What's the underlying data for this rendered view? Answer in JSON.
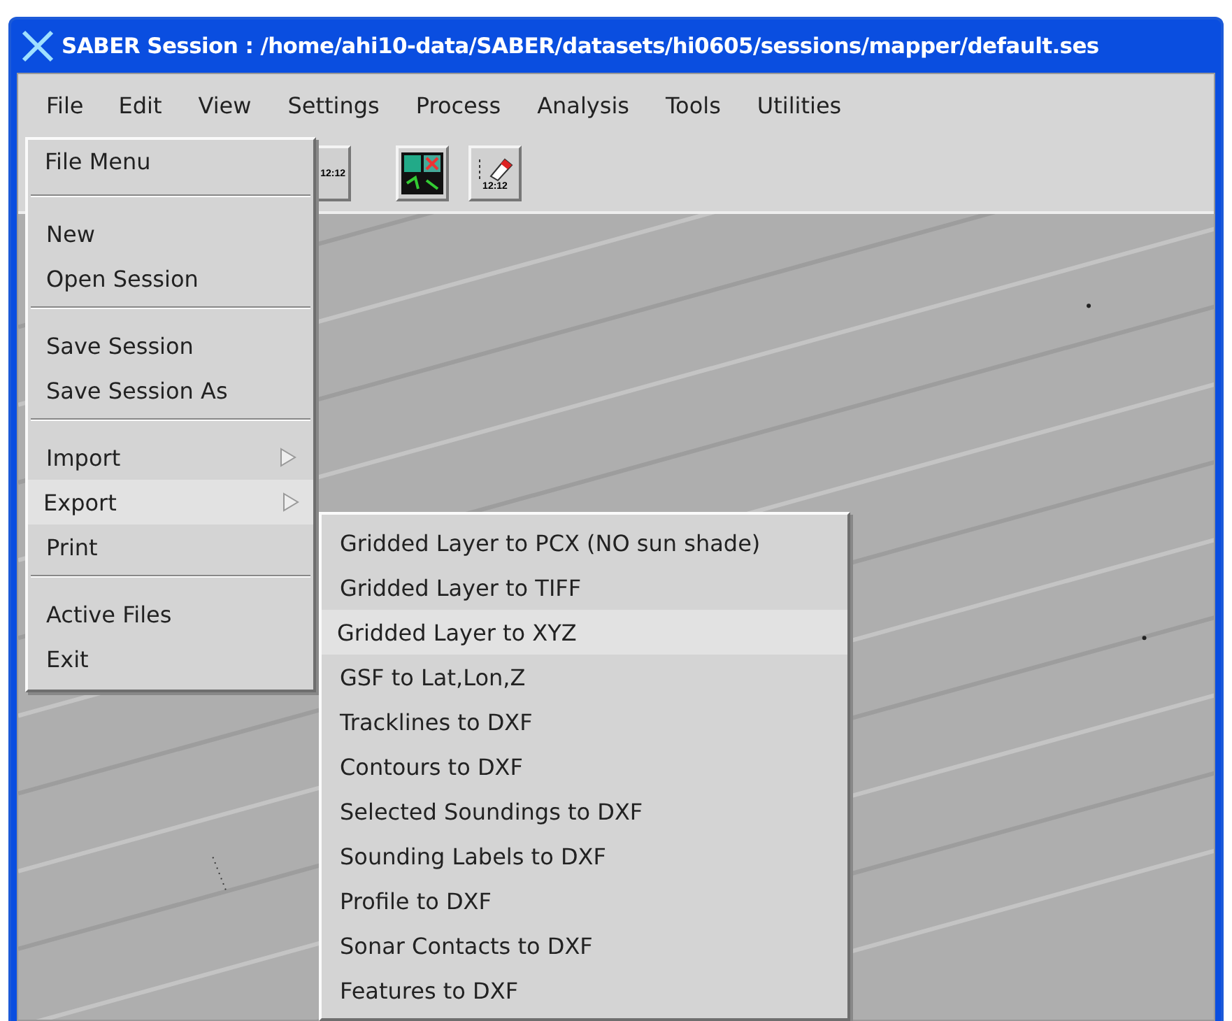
{
  "window": {
    "title": "SABER Session : /home/ahi10-data/SABER/datasets/hi0605/sessions/mapper/default.ses"
  },
  "menubar": [
    {
      "label": "File",
      "selected": true
    },
    {
      "label": "Edit",
      "selected": false
    },
    {
      "label": "View",
      "selected": false
    },
    {
      "label": "Settings",
      "selected": false
    },
    {
      "label": "Process",
      "selected": false
    },
    {
      "label": "Analysis",
      "selected": false
    },
    {
      "label": "Tools",
      "selected": false
    },
    {
      "label": "Utilities",
      "selected": false
    }
  ],
  "toolbar": [
    {
      "kind": "label-tool",
      "label": "12:12"
    },
    {
      "kind": "map-tool"
    },
    {
      "kind": "erase-tool",
      "label": "12:12"
    }
  ],
  "file_menu": {
    "title": "File Menu",
    "groups": [
      [
        {
          "label": "New",
          "selected": false,
          "submenu": false
        },
        {
          "label": "Open Session",
          "selected": false,
          "submenu": false
        }
      ],
      [
        {
          "label": "Save Session",
          "selected": false,
          "submenu": false
        },
        {
          "label": "Save Session As",
          "selected": false,
          "submenu": false
        }
      ],
      [
        {
          "label": "Import",
          "selected": false,
          "submenu": true
        },
        {
          "label": "Export",
          "selected": true,
          "submenu": true
        },
        {
          "label": "Print",
          "selected": false,
          "submenu": false
        }
      ],
      [
        {
          "label": "Active Files",
          "selected": false,
          "submenu": false
        },
        {
          "label": "Exit",
          "selected": false,
          "submenu": false
        }
      ]
    ]
  },
  "export_menu": [
    {
      "label": "Gridded Layer to PCX (NO sun shade)",
      "selected": false
    },
    {
      "label": "Gridded Layer to TIFF",
      "selected": false
    },
    {
      "label": "Gridded Layer to XYZ",
      "selected": true
    },
    {
      "label": "GSF to Lat,Lon,Z",
      "selected": false
    },
    {
      "label": "Tracklines to DXF",
      "selected": false
    },
    {
      "label": "Contours to DXF",
      "selected": false
    },
    {
      "label": "Selected Soundings to DXF",
      "selected": false
    },
    {
      "label": "Sounding Labels to DXF",
      "selected": false
    },
    {
      "label": "Profile to DXF",
      "selected": false
    },
    {
      "label": "Sonar Contacts to DXF",
      "selected": false
    },
    {
      "label": "Features to DXF",
      "selected": false
    }
  ]
}
